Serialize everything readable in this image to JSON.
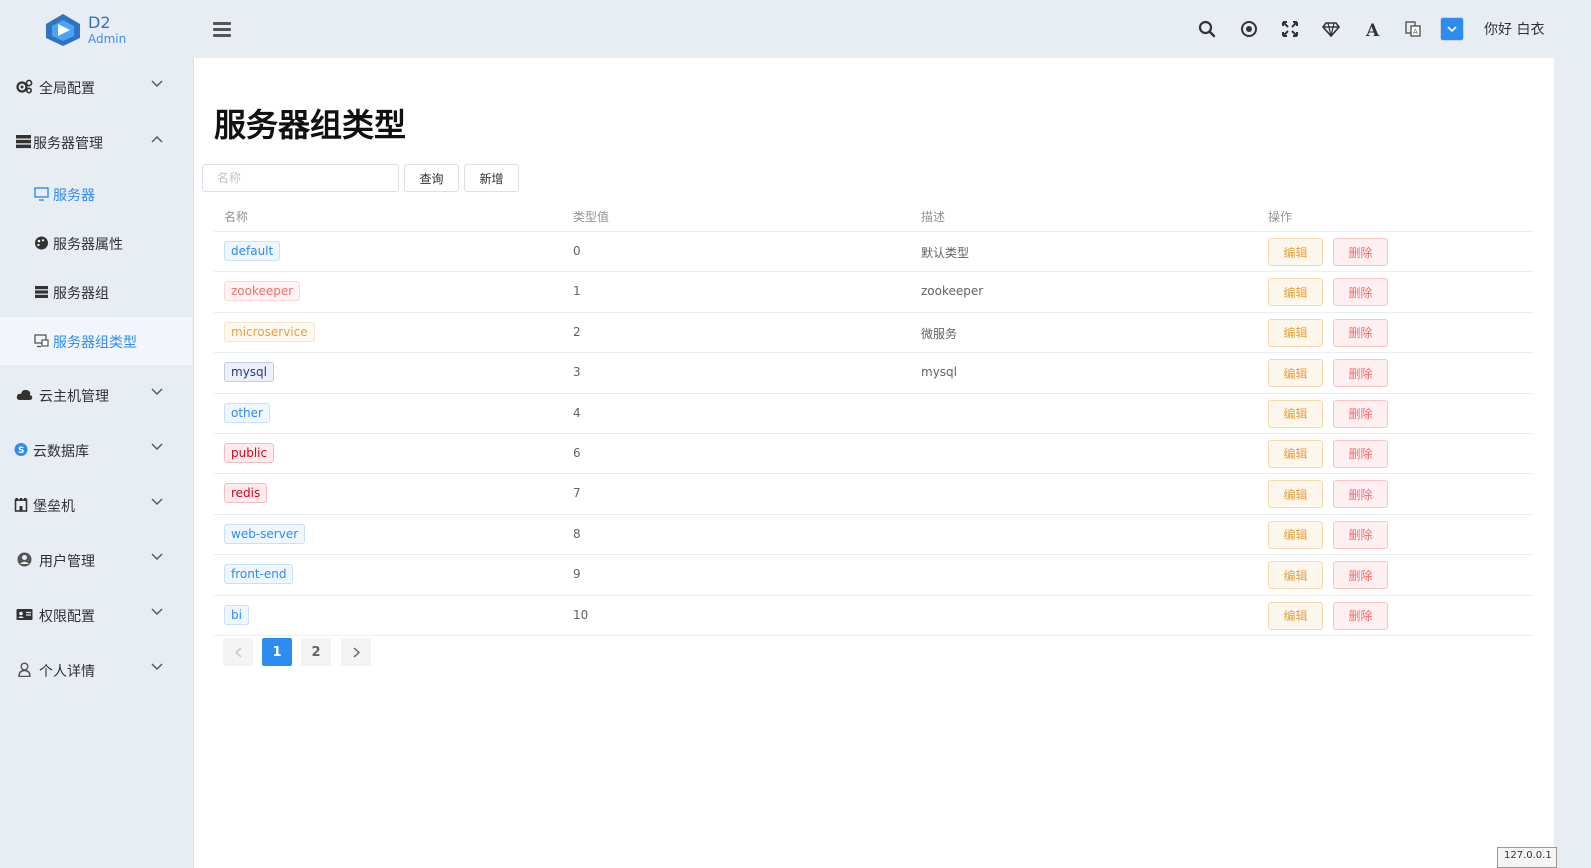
{
  "header": {
    "logo_title": "D2",
    "logo_sub": "Admin",
    "greeting": "你好 白衣"
  },
  "sidebar": {
    "items": [
      {
        "label": "全局配置",
        "icon": "gears-icon",
        "expanded": false
      },
      {
        "label": "服务器管理",
        "icon": "server-stack-icon",
        "expanded": true,
        "children": [
          {
            "label": "服务器",
            "icon": "monitor-icon"
          },
          {
            "label": "服务器属性",
            "icon": "palette-icon"
          },
          {
            "label": "服务器组",
            "icon": "server-stack-icon"
          },
          {
            "label": "服务器组类型",
            "icon": "monitor-icon",
            "active": true
          }
        ]
      },
      {
        "label": "云主机管理",
        "icon": "cloud-icon",
        "expanded": false
      },
      {
        "label": "云数据库",
        "icon": "database-icon",
        "expanded": false
      },
      {
        "label": "堡垒机",
        "icon": "fortress-icon",
        "expanded": false
      },
      {
        "label": "用户管理",
        "icon": "user-circle-icon",
        "expanded": false
      },
      {
        "label": "权限配置",
        "icon": "id-card-icon",
        "expanded": false
      },
      {
        "label": "个人详情",
        "icon": "user-outline-icon",
        "expanded": false
      }
    ]
  },
  "main": {
    "title": "服务器组类型",
    "search_placeholder": "名称",
    "query_label": "查询",
    "add_label": "新增",
    "columns": [
      "名称",
      "类型值",
      "描述",
      "操作"
    ],
    "edit_label": "编辑",
    "delete_label": "删除",
    "rows": [
      {
        "name": "default",
        "value": "0",
        "desc": "默认类型",
        "tag_color": "#2d8cf0"
      },
      {
        "name": "zookeeper",
        "value": "1",
        "desc": "zookeeper",
        "tag_color": "#f56c6c"
      },
      {
        "name": "microservice",
        "value": "2",
        "desc": "微服务",
        "tag_color": "#e6a23c"
      },
      {
        "name": "mysql",
        "value": "3",
        "desc": "mysql",
        "tag_color": "#1f3a93"
      },
      {
        "name": "other",
        "value": "4",
        "desc": "",
        "tag_color": "#2d8cf0"
      },
      {
        "name": "public",
        "value": "6",
        "desc": "",
        "tag_color": "#d9001b"
      },
      {
        "name": "redis",
        "value": "7",
        "desc": "",
        "tag_color": "#d9001b"
      },
      {
        "name": "web-server",
        "value": "8",
        "desc": "",
        "tag_color": "#2d8cf0"
      },
      {
        "name": "front-end",
        "value": "9",
        "desc": "",
        "tag_color": "#2d8cf0"
      },
      {
        "name": "bi",
        "value": "10",
        "desc": "",
        "tag_color": "#2d8cf0"
      }
    ],
    "pages": [
      "1",
      "2"
    ],
    "current_page": "1"
  },
  "version_badge": "127.0.0.1"
}
